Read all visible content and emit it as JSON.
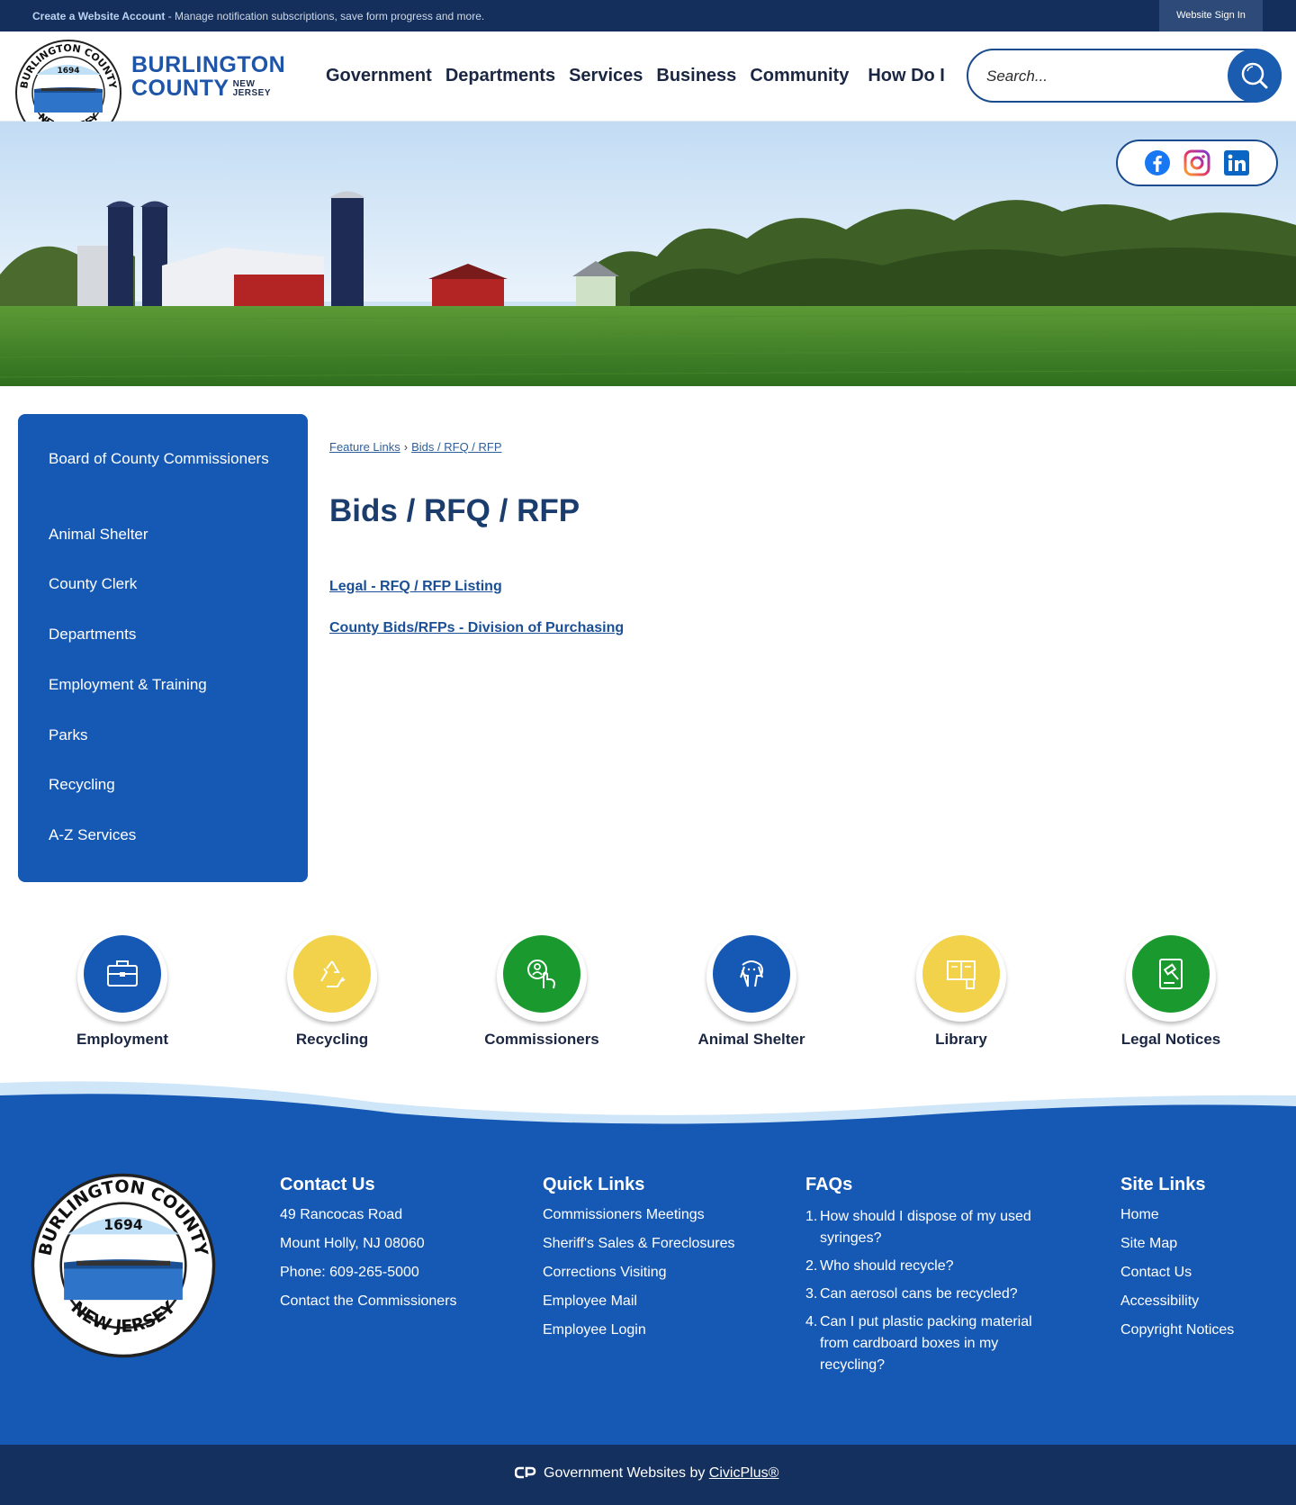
{
  "topbar": {
    "create_account": "Create a Website Account",
    "create_account_rest": " - Manage notification subscriptions, save form progress and more.",
    "sign_in": "Website Sign In"
  },
  "header": {
    "brand_line1": "BURLINGTON",
    "brand_line2": "COUNTY",
    "brand_nj_1": "NEW",
    "brand_nj_2": "JERSEY",
    "seal_text_top": "BURLINGTON COUNTY",
    "seal_text_bottom": "NEW JERSEY",
    "seal_year": "1694"
  },
  "nav": [
    "Government",
    "Departments",
    "Services",
    "Business",
    "Community",
    "How Do I"
  ],
  "search": {
    "placeholder": "Search..."
  },
  "social": [
    "facebook-icon",
    "instagram-icon",
    "linkedin-icon"
  ],
  "sidebar": {
    "items": [
      {
        "label": "Board of County Commissioners"
      },
      {
        "label": "Animal Shelter"
      },
      {
        "label": "County Clerk"
      },
      {
        "label": "Departments"
      },
      {
        "label": "Employment & Training"
      },
      {
        "label": "Parks"
      },
      {
        "label": "Recycling"
      },
      {
        "label": "A-Z Services"
      }
    ]
  },
  "breadcrumb": {
    "home": "Feature Links",
    "separator": "›",
    "current": "Bids / RFQ / RFP"
  },
  "main": {
    "title": "Bids / RFQ / RFP",
    "links": [
      "Legal - RFQ / RFP Listing",
      "County Bids/RFPs - Division of Purchasing"
    ]
  },
  "quick_icons": [
    {
      "label": "Employment",
      "icon": "briefcase-icon",
      "color": "#1659b5"
    },
    {
      "label": "Recycling",
      "icon": "recycle-icon",
      "color": "#f2d24a"
    },
    {
      "label": "Commissioners",
      "icon": "hand-pointer-icon",
      "color": "#1a9a2e"
    },
    {
      "label": "Animal Shelter",
      "icon": "dog-icon",
      "color": "#1659b5"
    },
    {
      "label": "Library",
      "icon": "book-icon",
      "color": "#f2d24a"
    },
    {
      "label": "Legal Notices",
      "icon": "gavel-icon",
      "color": "#1a9a2e"
    }
  ],
  "footer": {
    "contact": {
      "title": "Contact Us",
      "address1": "49 Rancocas Road",
      "address2": "Mount Holly, NJ 08060",
      "phone": "Phone: 609-265-5000",
      "link": "Contact the Commissioners"
    },
    "quick_links": {
      "title": "Quick Links",
      "items": [
        "Commissioners Meetings",
        "Sheriff's Sales & Foreclosures",
        "Corrections Visiting",
        "Employee Mail",
        "Employee Login"
      ]
    },
    "faqs": {
      "title": "FAQs",
      "items": [
        "How should I dispose of my used syringes?",
        "Who should recycle?",
        "Can aerosol cans be recycled?",
        "Can I put plastic packing material from cardboard boxes in my recycling?"
      ]
    },
    "site_links": {
      "title": "Site Links",
      "items": [
        "Home",
        "Site Map",
        "Contact Us",
        "Accessibility",
        "Copyright Notices"
      ]
    },
    "credit_prefix": "Government Websites by",
    "credit_link": "CivicPlus®"
  },
  "colors": {
    "primary": "#1659b5",
    "dark": "#142f5c",
    "yellow": "#f2d24a",
    "green": "#1a9a2e"
  }
}
